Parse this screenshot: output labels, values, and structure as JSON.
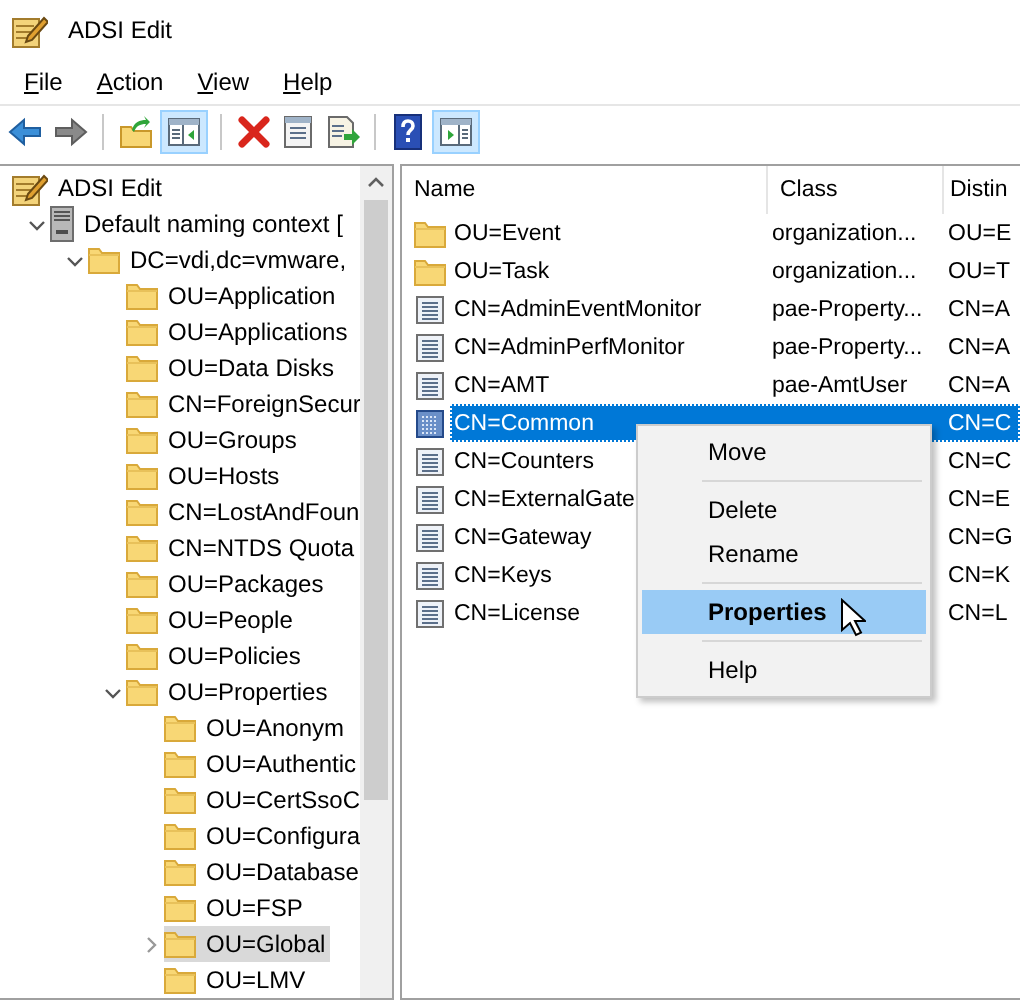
{
  "window": {
    "title": "ADSI Edit"
  },
  "menu": [
    {
      "label": "File"
    },
    {
      "label": "Action"
    },
    {
      "label": "View"
    },
    {
      "label": "Help"
    }
  ],
  "toolbar": [
    {
      "kind": "back",
      "pressed": false
    },
    {
      "kind": "forward",
      "pressed": false
    },
    {
      "kind": "separator"
    },
    {
      "kind": "up",
      "pressed": false
    },
    {
      "kind": "console-tree",
      "pressed": true
    },
    {
      "kind": "separator"
    },
    {
      "kind": "delete",
      "pressed": false
    },
    {
      "kind": "properties",
      "pressed": false
    },
    {
      "kind": "export",
      "pressed": false
    },
    {
      "kind": "separator"
    },
    {
      "kind": "help",
      "pressed": false
    },
    {
      "kind": "action-pane",
      "pressed": true
    }
  ],
  "tree": [
    {
      "label": "ADSI Edit",
      "kind": "adsi",
      "selected": false,
      "children": [
        {
          "label": "Default naming context [",
          "kind": "server",
          "expanded": true,
          "selected": false,
          "children": [
            {
              "label": "DC=vdi,dc=vmware,",
              "kind": "folder",
              "expanded": true,
              "selected": false,
              "children": [
                {
                  "label": "OU=Application",
                  "kind": "folder",
                  "selected": false
                },
                {
                  "label": "OU=Applications",
                  "kind": "folder",
                  "selected": false
                },
                {
                  "label": "OU=Data Disks",
                  "kind": "folder",
                  "selected": false
                },
                {
                  "label": "CN=ForeignSecur",
                  "kind": "folder",
                  "selected": false
                },
                {
                  "label": "OU=Groups",
                  "kind": "folder",
                  "selected": false
                },
                {
                  "label": "OU=Hosts",
                  "kind": "folder",
                  "selected": false
                },
                {
                  "label": "CN=LostAndFoun",
                  "kind": "folder",
                  "selected": false
                },
                {
                  "label": "CN=NTDS Quota",
                  "kind": "folder",
                  "selected": false
                },
                {
                  "label": "OU=Packages",
                  "kind": "folder",
                  "selected": false
                },
                {
                  "label": "OU=People",
                  "kind": "folder",
                  "selected": false
                },
                {
                  "label": "OU=Policies",
                  "kind": "folder",
                  "selected": false
                },
                {
                  "label": "OU=Properties",
                  "kind": "folder",
                  "expanded": true,
                  "selected": false,
                  "children": [
                    {
                      "label": "OU=Anonym",
                      "kind": "folder",
                      "selected": false
                    },
                    {
                      "label": "OU=Authentic",
                      "kind": "folder",
                      "selected": false
                    },
                    {
                      "label": "OU=CertSsoC",
                      "kind": "folder",
                      "selected": false
                    },
                    {
                      "label": "OU=Configura",
                      "kind": "folder",
                      "selected": false
                    },
                    {
                      "label": "OU=Database",
                      "kind": "folder",
                      "selected": false
                    },
                    {
                      "label": "OU=FSP",
                      "kind": "folder",
                      "selected": false
                    },
                    {
                      "label": "OU=Global",
                      "kind": "folder",
                      "expanded": false,
                      "selected": true
                    },
                    {
                      "label": "OU=LMV",
                      "kind": "folder",
                      "selected": false
                    }
                  ]
                }
              ]
            }
          ]
        }
      ]
    }
  ],
  "list": {
    "columns": [
      "Name",
      "Class",
      "Distin"
    ],
    "rows": [
      {
        "kind": "folder",
        "name": "OU=Event",
        "class": "organization...",
        "dn": "OU=E",
        "selected": false
      },
      {
        "kind": "folder",
        "name": "OU=Task",
        "class": "organization...",
        "dn": "OU=T",
        "selected": false
      },
      {
        "kind": "object",
        "name": "CN=AdminEventMonitor",
        "class": "pae-Property...",
        "dn": "CN=A",
        "selected": false
      },
      {
        "kind": "object",
        "name": "CN=AdminPerfMonitor",
        "class": "pae-Property...",
        "dn": "CN=A",
        "selected": false
      },
      {
        "kind": "object",
        "name": "CN=AMT",
        "class": "pae-AmtUser",
        "dn": "CN=A",
        "selected": false
      },
      {
        "kind": "object",
        "name": "CN=Common",
        "dn": "CN=C",
        "selected": true
      },
      {
        "kind": "object",
        "name": "CN=Counters",
        "dn": "CN=C",
        "selected": false
      },
      {
        "kind": "object",
        "name": "CN=ExternalGate",
        "dn": "CN=E",
        "selected": false
      },
      {
        "kind": "object",
        "name": "CN=Gateway",
        "dn": "CN=G",
        "selected": false
      },
      {
        "kind": "object",
        "name": "CN=Keys",
        "dn": "CN=K",
        "selected": false
      },
      {
        "kind": "object",
        "name": "CN=License",
        "dn": "CN=L",
        "selected": false
      }
    ]
  },
  "context_menu": [
    {
      "kind": "item",
      "label": "Move",
      "selected": false,
      "default": false
    },
    {
      "kind": "separator"
    },
    {
      "kind": "item",
      "label": "Delete",
      "selected": false,
      "default": false
    },
    {
      "kind": "item",
      "label": "Rename",
      "selected": false,
      "default": false
    },
    {
      "kind": "separator"
    },
    {
      "kind": "item",
      "label": "Properties",
      "selected": true,
      "default": true
    },
    {
      "kind": "separator"
    },
    {
      "kind": "item",
      "label": "Help",
      "selected": false,
      "default": false
    }
  ]
}
